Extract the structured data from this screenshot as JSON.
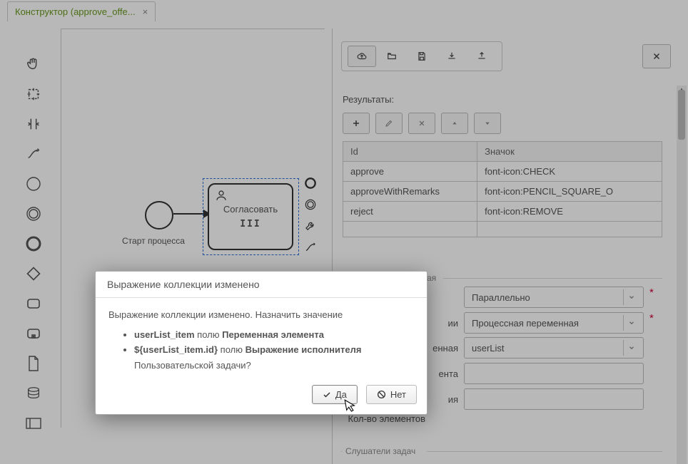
{
  "tab": {
    "title": "Конструктор (approve_offe...",
    "close": "×"
  },
  "canvas": {
    "start_label": "Старт процесса",
    "task_label": "Согласовать"
  },
  "panel": {
    "results_label": "Результаты:",
    "table": {
      "cols": [
        "Id",
        "Значок"
      ],
      "rows": [
        {
          "id": "approve",
          "icon": "font-icon:CHECK"
        },
        {
          "id": "approveWithRemarks",
          "icon": "font-icon:PENCIL_SQUARE_O"
        },
        {
          "id": "reject",
          "icon": "font-icon:REMOVE"
        }
      ]
    },
    "section_multi": "ая",
    "fields": {
      "multi_mode": {
        "label": "",
        "value": "Параллельно",
        "required": true
      },
      "source": {
        "label": "ии",
        "value": "Процессная переменная",
        "required": true
      },
      "collection": {
        "label": "енная",
        "value": "userList"
      },
      "element_var": {
        "label": "ента",
        "value": ""
      },
      "expression": {
        "label": "ия",
        "value": ""
      },
      "count": {
        "label": "Кол-во элементов",
        "value": ""
      }
    },
    "section_listeners": "Слушатели задач"
  },
  "modal": {
    "title": "Выражение коллекции изменено",
    "text": "Выражение коллекции изменено. Назначить значение",
    "li1_b": "userList_item",
    "li1_t": " полю ",
    "li1_b2": "Переменная элемента",
    "li2_b": "${userList_item.id}",
    "li2_t": " полю ",
    "li2_b2": "Выражение исполнителя",
    "tail": "Пользовательской задачи?",
    "yes": "Да",
    "no": "Нет"
  }
}
